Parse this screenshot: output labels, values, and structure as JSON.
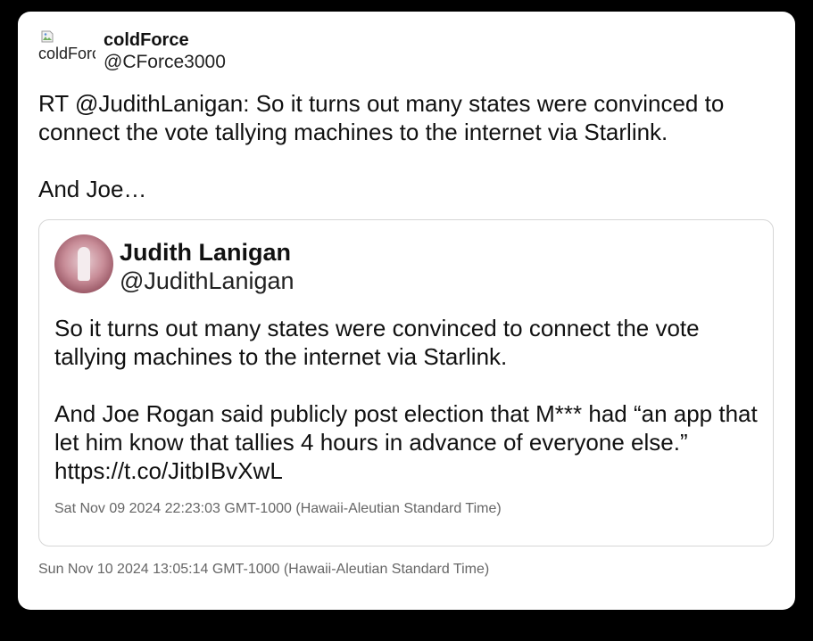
{
  "tweet": {
    "avatar_alt": "coldForce",
    "display_name": "coldForce",
    "handle": "@CForce3000",
    "text": "RT @JudithLanigan: So it turns out many states were convinced to connect the vote tallying machines to the internet via Starlink.\n\nAnd Joe…",
    "timestamp": "Sun Nov 10 2024 13:05:14 GMT-1000 (Hawaii-Aleutian Standard Time)"
  },
  "quoted": {
    "display_name": "Judith Lanigan",
    "handle": "@JudithLanigan",
    "text": "So it turns out many states were convinced to connect the vote tallying machines to the internet via Starlink.\n\nAnd Joe Rogan said publicly post election that M*** had “an app that let him know that tallies 4 hours in advance of everyone else.” https://t.co/JitbIBvXwL",
    "timestamp": "Sat Nov 09 2024 22:23:03 GMT-1000 (Hawaii-Aleutian Standard Time)"
  },
  "icons": {
    "broken_image": "broken-image-icon"
  },
  "colors": {
    "background": "#000000",
    "card": "#ffffff",
    "text": "#111111",
    "muted": "#666666",
    "border": "#d6d6d6"
  }
}
